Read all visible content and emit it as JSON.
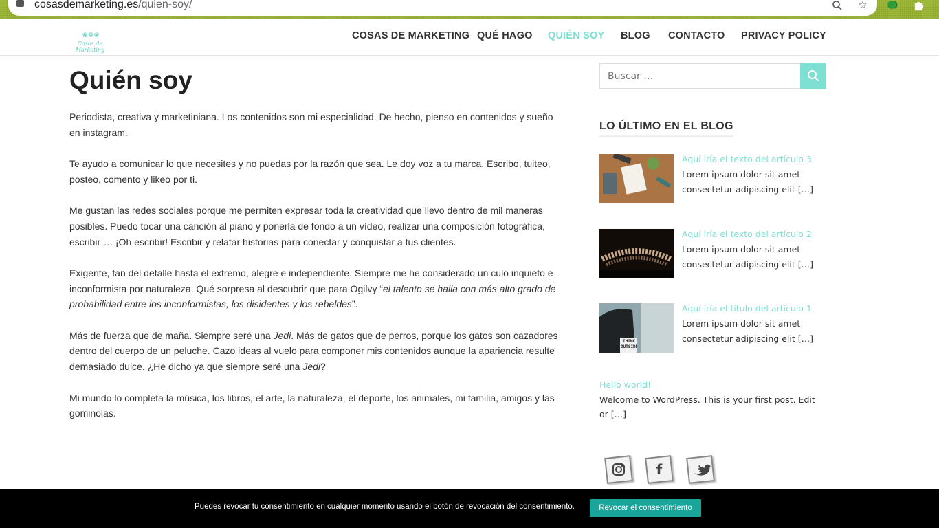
{
  "browser": {
    "url_host": "cosasdemarketing.es",
    "url_path": "/quien-soy/",
    "icons": [
      "lock-icon",
      "zoom-icon",
      "star-icon",
      "extension-status-icon",
      "puzzle-icon"
    ]
  },
  "header": {
    "logo_text": "Cosas de Marketing",
    "nav": [
      {
        "label": "COSAS DE MARKETING",
        "active": false
      },
      {
        "label": "QUÉ HAGO",
        "active": false
      },
      {
        "label": "QUIÉN SOY",
        "active": true
      },
      {
        "label": "BLOG",
        "active": false
      },
      {
        "label": "CONTACTO",
        "active": false
      },
      {
        "label": "PRIVACY POLICY",
        "active": false
      }
    ]
  },
  "main": {
    "title": "Quién soy",
    "paragraphs": [
      "Periodista, creativa y marketiniana. Los contenidos son mi especialidad. De hecho, pienso en contenidos y sueño en instagram.",
      "Te ayudo a comunicar lo que necesites y no puedas por la razón que sea. Le doy voz a tu marca. Escribo, tuiteo, posteo, comento y likeo por ti.",
      "Me gustan las redes sociales porque me permiten expresar toda la creatividad que llevo dentro de mil maneras posibles. Puedo tocar una canción al piano y ponerla de fondo a un vídeo, realizar una composición fotográfica, escribir…. ¡Oh escribir! Escribir y relatar historias para conectar y conquistar a tus clientes."
    ],
    "p4_text": "Exigente, fan del detalle hasta el extremo, alegre e independiente. Siempre me he considerado un culo inquieto e inconformista por naturaleza. Qué sorpresa al descubrir que para Ogilvy “",
    "p4_quote": "el talento se halla con más alto grado de probabilidad entre los inconformistas, los disidentes y los rebeldes",
    "p4_end": "”.",
    "p5_a": "Más de fuerza que de maña. Siempre seré una ",
    "p5_jedi1": "Jedi",
    "p5_b": ". Más de gatos que de perros, porque los gatos son cazadores dentro del cuerpo de un peluche. Cazo ideas al vuelo para componer mis contenidos aunque la apariencia resulte demasiado dulce. ¿He dicho ya que siempre seré una ",
    "p5_jedi2": "Jedi",
    "p5_c": "?",
    "p6": "Mi mundo lo completa la música, los libros, el arte, la naturaleza, el deporte, los animales, mi familia, amigos y las gominolas."
  },
  "sidebar": {
    "search_placeholder": "Buscar …",
    "widget_title": "LO ÚLTIMO EN EL BLOG",
    "posts": [
      {
        "title": "Aquí iría el texto del artículo 3",
        "excerpt": "Lorem ipsum dolor sit amet consectetur adipiscing elit […]"
      },
      {
        "title": "Aquí iría el texto del artículo 2",
        "excerpt": "Lorem ipsum dolor sit amet consectetur adipiscing elit […]"
      },
      {
        "title": "Aquí iría el título del artículo 1",
        "excerpt": "Lorem ipsum dolor sit amet consectetur adipiscing elit […]"
      }
    ],
    "hello_title": "Hello world!",
    "hello_excerpt": "Welcome to WordPress. This is your first post. Edit or […]",
    "thumb3_sign": "THINK OUTSIDE",
    "social": [
      "instagram-icon",
      "facebook-icon",
      "twitter-icon"
    ]
  },
  "cookie": {
    "text": "Puedes revocar tu consentimiento en cualquier momento usando el botón de revocación del consentimiento.",
    "button": "Revocar el consentimiento"
  },
  "colors": {
    "accent": "#7ee0d2",
    "browser_bar": "#9fb83a",
    "cookie_button": "#1aa59a"
  }
}
